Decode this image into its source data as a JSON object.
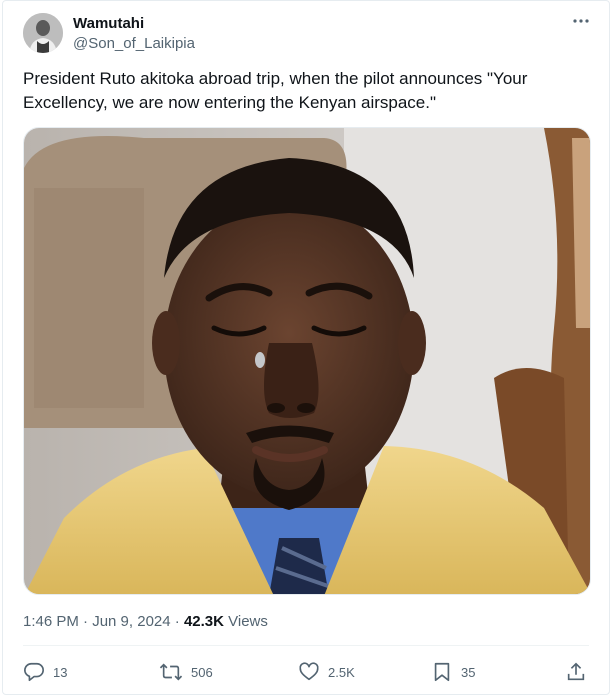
{
  "author": {
    "display_name": "Wamutahi",
    "handle": "@Son_of_Laikipia"
  },
  "tweet": {
    "text": "President Ruto akitoka abroad trip, when the pilot announces \"Your Excellency, we are now entering the Kenyan airspace.\"",
    "timestamp": "1:46 PM · Jun 9, 2024",
    "views_count": "42.3K",
    "views_label": "Views"
  },
  "actions": {
    "replies": "13",
    "reposts": "506",
    "likes": "2.5K",
    "bookmarks": "35"
  },
  "colors": {
    "text": "#0f1419",
    "muted": "#536471",
    "border": "#e6ecf0"
  },
  "icons": [
    "more-icon",
    "reply-icon",
    "repost-icon",
    "like-icon",
    "bookmark-icon",
    "share-icon"
  ]
}
